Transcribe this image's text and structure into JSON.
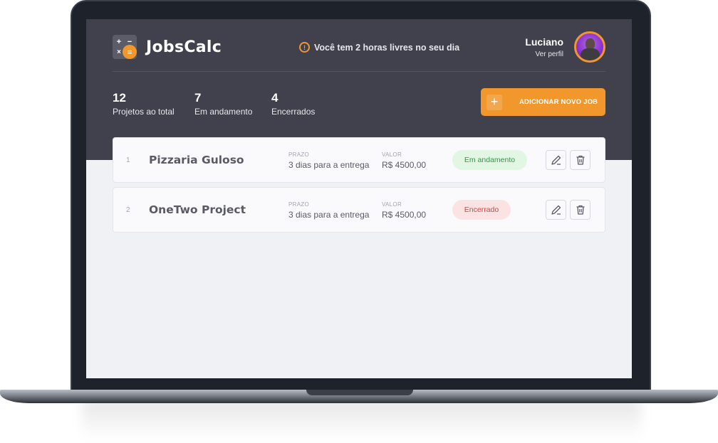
{
  "app": {
    "name": "JobsCalc"
  },
  "alert": {
    "text": "Você tem 2 horas livres no seu dia"
  },
  "user": {
    "name": "Luciano",
    "profile_link": "Ver perfil"
  },
  "stats": [
    {
      "value": "12",
      "label": "Projetos ao total"
    },
    {
      "value": "7",
      "label": "Em andamento"
    },
    {
      "value": "4",
      "label": "Encerrados"
    }
  ],
  "add_button": {
    "icon": "+",
    "label": "ADICIONAR NOVO JOB"
  },
  "jobs": [
    {
      "index": "1",
      "name": "Pizzaria Guloso",
      "deadline_label": "PRAZO",
      "deadline": "3 dias para a entrega",
      "value_label": "VALOR",
      "value": "R$ 4500,00",
      "status": "Em andamento",
      "status_color": "#2c9b3b"
    },
    {
      "index": "2",
      "name": "OneTwo Project",
      "deadline_label": "PRAZO",
      "deadline": "3 dias para a entrega",
      "value_label": "VALOR",
      "value": "R$ 4500,00",
      "status": "Encerrado",
      "status_color": "#d54343"
    }
  ],
  "colors": {
    "brand": "#f1972c",
    "header": "#41414d",
    "background": "#f0f1f5"
  },
  "icons": {
    "logo": "calculator-icon",
    "alert": "alert-circle-icon",
    "edit": "pencil-icon",
    "delete": "trash-icon"
  }
}
